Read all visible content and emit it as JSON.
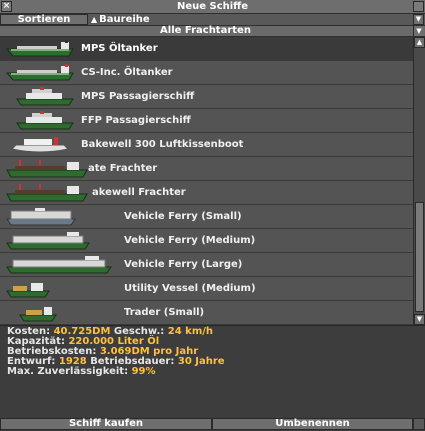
{
  "window": {
    "title": "Neue Schiffe"
  },
  "sort": {
    "button_label": "Sortieren",
    "criterion": "Baureihe"
  },
  "cargo_filter": {
    "selected": "Alle Frachtarten"
  },
  "ships": [
    {
      "name": "MPS Öltanker",
      "selected": true,
      "icon": "oil-tanker-icon"
    },
    {
      "name": "CS-Inc. Öltanker",
      "icon": "oil-tanker-icon"
    },
    {
      "name": "MPS Passagierschiff",
      "icon": "passenger-ship-icon"
    },
    {
      "name": "FFP Passagierschiff",
      "icon": "passenger-ship-icon"
    },
    {
      "name": "Bakewell 300 Luftkissenboot",
      "icon": "hovercraft-icon"
    },
    {
      "name": "ate Frachter",
      "icon": "cargo-ship-icon"
    },
    {
      "name": "akewell Frachter",
      "icon": "cargo-ship-icon"
    },
    {
      "name": "Vehicle Ferry (Small)",
      "icon": "vehicle-ferry-icon"
    },
    {
      "name": "Vehicle Ferry (Medium)",
      "icon": "vehicle-ferry-icon"
    },
    {
      "name": "Vehicle Ferry (Large)",
      "icon": "vehicle-ferry-icon"
    },
    {
      "name": "Utility Vessel (Medium)",
      "icon": "utility-vessel-icon"
    },
    {
      "name": "Trader (Small)",
      "icon": "trader-ship-icon"
    }
  ],
  "details": {
    "cost_label": "Kosten:",
    "cost_value": "40.725DM",
    "speed_label": "Geschw.:",
    "speed_value": "24 km/h",
    "capacity_label": "Kapazität:",
    "capacity_value": "220.000 Liter Öl",
    "running_label": "Betriebskosten:",
    "running_value": "3.069DM pro Jahr",
    "design_label": "Entwurf:",
    "design_value": "1928",
    "life_label": "Betriebsdauer:",
    "life_value": "30 Jahre",
    "reliability_label": "Max. Zuverlässigkeit:",
    "reliability_value": "99%"
  },
  "buttons": {
    "buy": "Schiff kaufen",
    "rename": "Umbenennen"
  },
  "colors": {
    "highlight": "#ffc23a",
    "panel": "#545454"
  }
}
